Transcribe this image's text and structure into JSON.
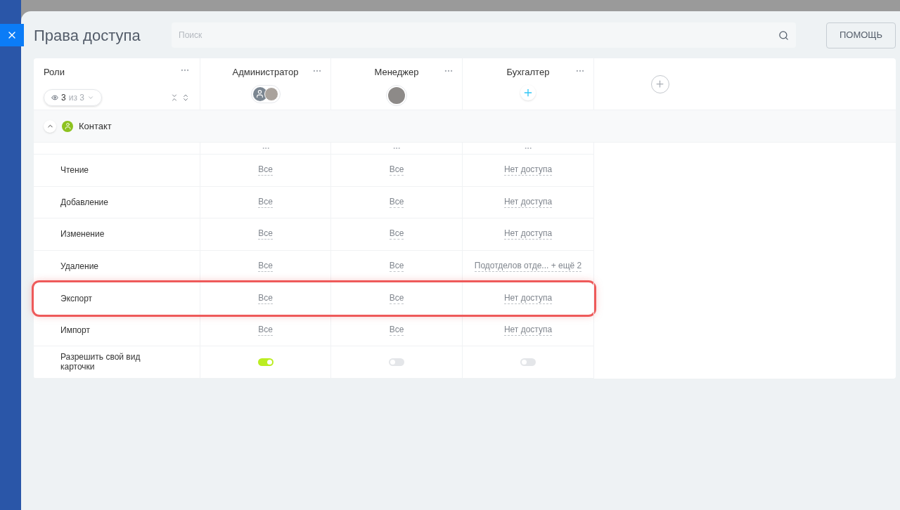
{
  "title": "Права доступа",
  "search": {
    "placeholder": "Поиск"
  },
  "help_button": "ПОМОЩЬ",
  "roles_header": {
    "label": "Роли",
    "filter_count": "3",
    "filter_total": "из 3"
  },
  "columns": [
    {
      "name": "Администратор",
      "kind": "group"
    },
    {
      "name": "Менеджер",
      "kind": "person"
    },
    {
      "name": "Бухгалтер",
      "kind": "add"
    }
  ],
  "group": {
    "label": "Контакт",
    "expanded": true
  },
  "rows": [
    {
      "label": "Чтение",
      "kind": "link",
      "highlighted": false,
      "cells": [
        "Все",
        "Все",
        "Нет доступа"
      ]
    },
    {
      "label": "Добавление",
      "kind": "link",
      "highlighted": false,
      "cells": [
        "Все",
        "Все",
        "Нет доступа"
      ]
    },
    {
      "label": "Изменение",
      "kind": "link",
      "highlighted": false,
      "cells": [
        "Все",
        "Все",
        "Нет доступа"
      ]
    },
    {
      "label": "Удаление",
      "kind": "link",
      "highlighted": false,
      "cells": [
        "Все",
        "Все",
        "Подотделов отде... + ещё 2"
      ]
    },
    {
      "label": "Экспорт",
      "kind": "link",
      "highlighted": true,
      "cells": [
        "Все",
        "Все",
        "Нет доступа"
      ]
    },
    {
      "label": "Импорт",
      "kind": "link",
      "highlighted": false,
      "cells": [
        "Все",
        "Все",
        "Нет доступа"
      ]
    },
    {
      "label": "Разрешить свой вид карточки",
      "kind": "toggle",
      "highlighted": false,
      "cells": [
        {
          "on": true
        },
        {
          "on": false
        },
        {
          "on": false
        }
      ]
    }
  ]
}
